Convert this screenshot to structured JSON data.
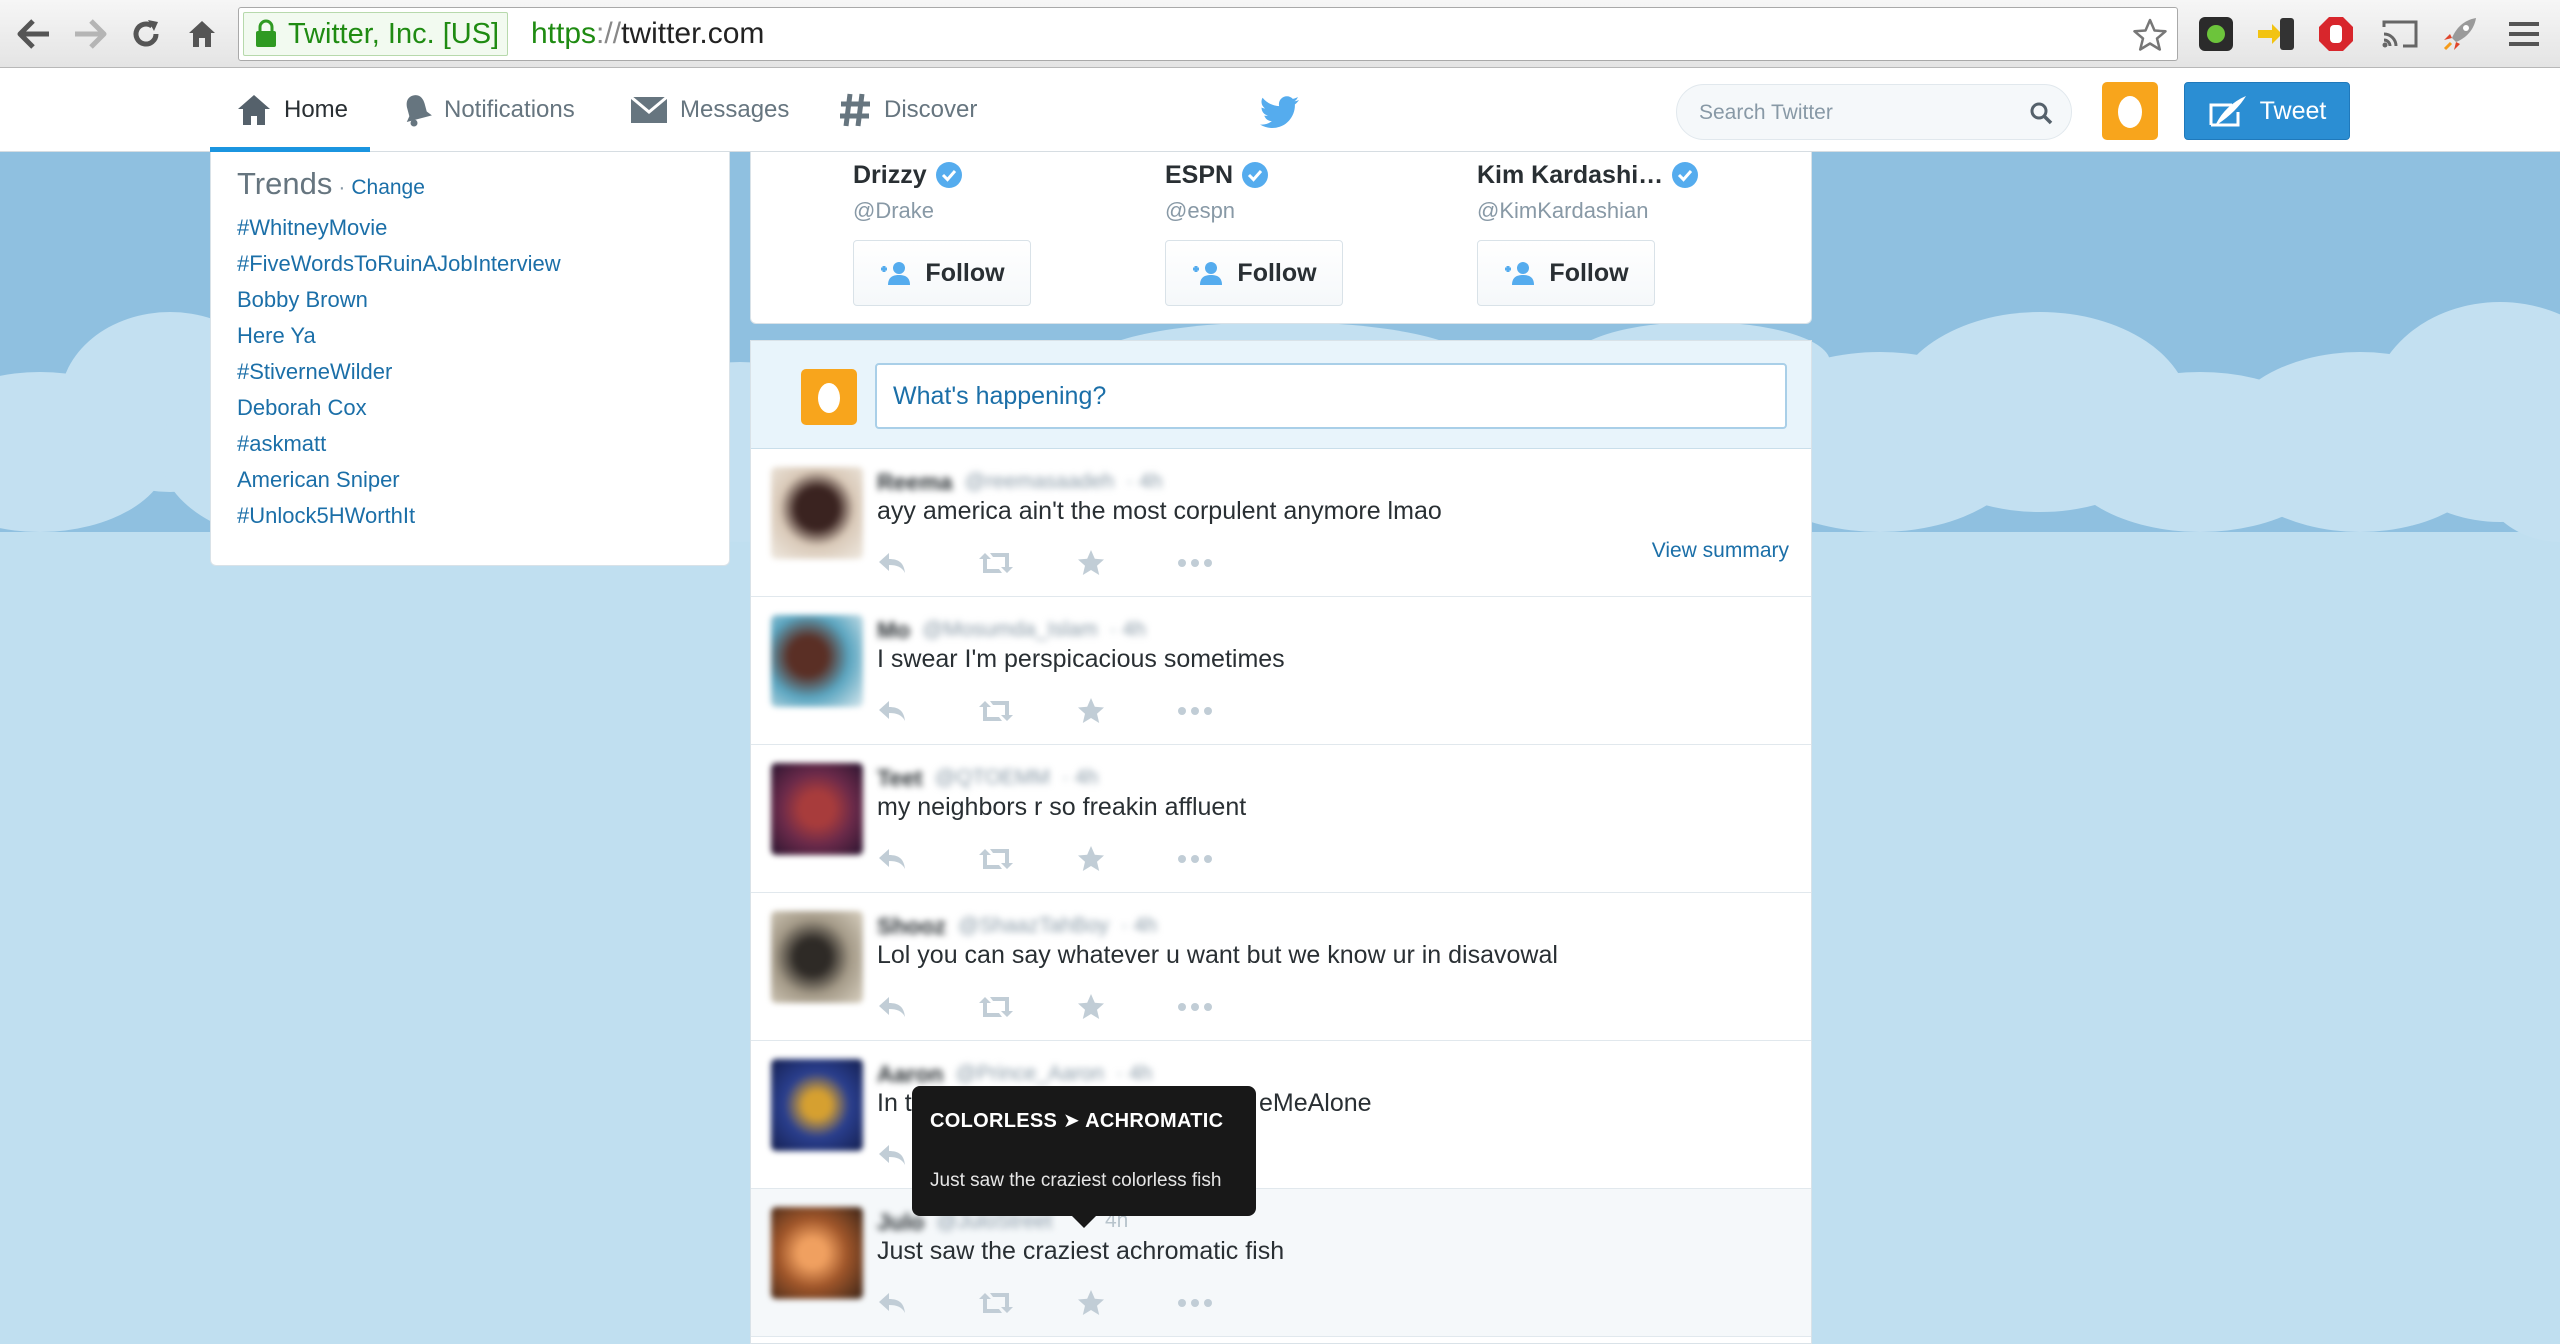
{
  "browser": {
    "security_badge": "Twitter, Inc. [US]",
    "url_scheme": "https",
    "url_sep": "://",
    "url_host": "twitter.com"
  },
  "nav": {
    "home": "Home",
    "notifications": "Notifications",
    "messages": "Messages",
    "discover": "Discover",
    "search_placeholder": "Search Twitter",
    "tweet_button": "Tweet"
  },
  "trends": {
    "title": "Trends",
    "separator": "·",
    "change": "Change",
    "items": [
      "#WhitneyMovie",
      "#FiveWordsToRuinAJobInterview",
      "Bobby Brown",
      "Here Ya",
      "#StiverneWilder",
      "Deborah Cox",
      "#askmatt",
      "American Sniper",
      "#Unlock5HWorthIt"
    ]
  },
  "who_to_follow": [
    {
      "name": "Drizzy",
      "handle": "@Drake",
      "button": "Follow"
    },
    {
      "name": "ESPN",
      "handle": "@espn",
      "button": "Follow"
    },
    {
      "name": "Kim Kardashi…",
      "handle": "@KimKardashian",
      "button": "Follow"
    }
  ],
  "composer": {
    "placeholder": "What's happening?"
  },
  "tweets": [
    {
      "name": "Reema",
      "handle": "@reemasaadeh",
      "time": "· 4h",
      "text": "ayy america ain't the most corpulent anymore lmao",
      "extra": "View summary"
    },
    {
      "name": "Mo",
      "handle": "@Mosumda_Islam",
      "time": "· 4h",
      "text": "I swear I'm perspicacious sometimes"
    },
    {
      "name": "Teet",
      "handle": "@QTOEMM",
      "time": "· 4h",
      "text": "my neighbors r so freakin affluent"
    },
    {
      "name": "Shooz",
      "handle": "@ShaazTahBoy",
      "time": "· 4h",
      "text": "Lol you can say whatever u want but we know ur in disavowal"
    },
    {
      "name": "Aaron",
      "handle": "@Prince_Aaron",
      "time": "· 4h",
      "text": "In t",
      "text_tail": "eMeAlone"
    },
    {
      "name": "Julo",
      "handle": "@JuloStreet",
      "time": "4h",
      "text": "Just saw the craziest achromatic fish"
    }
  ],
  "tooltip": {
    "heading": "COLORLESS ➤ ACHROMATIC",
    "body": "Just saw the craziest colorless fish"
  },
  "colors": {
    "twitter_blue": "#55acee",
    "link": "#1b6fa8",
    "tweet_button": "#2b8ed3",
    "egg_avatar": "#f8a51c",
    "background": "#c0dff0"
  }
}
